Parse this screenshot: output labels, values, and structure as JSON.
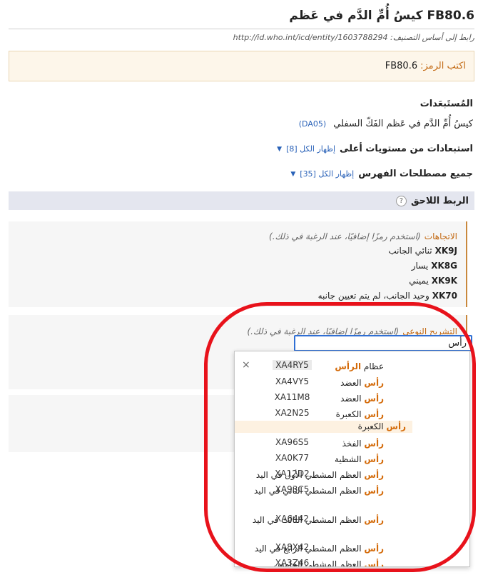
{
  "header": {
    "code": "FB80.6",
    "title": "كيسُ أُمِّ الدَّم في عَظم",
    "uri_label": "رابط إلى أساس التصنيف:",
    "uri": "http://id.who.int/icd/entity/1603788294"
  },
  "code_box": {
    "label": "اكتب الرمز:",
    "code": "FB80.6"
  },
  "exclusions": {
    "heading": "المُستَبعَدات",
    "item_text": "كيسُ أُمِّ الدَّم في عَظم الفَكّ السفلي",
    "item_ref": "(DA05)"
  },
  "higher_exclusions": {
    "label": "استبعادات من مستويات أعلى",
    "show_all": "إظهار الكل [8]"
  },
  "index_terms": {
    "label": "جميع مصطلحات الفهرس",
    "show_all": "إظهار الكل [35]"
  },
  "postcoordination": {
    "label": "الربط اللاحق",
    "help": "?"
  },
  "laterality": {
    "name": "الاتجاهات",
    "hint": "(استخدم رمزًا إضافيًا، عند الرغبة في ذلك.)",
    "items": [
      {
        "code": "XK9J",
        "label": "ثنائي الجانب"
      },
      {
        "code": "XK8G",
        "label": "يسار"
      },
      {
        "code": "XK9K",
        "label": "يميني"
      },
      {
        "code": "XK70",
        "label": "وحيد الجانب، لم يتم تعيين جانبه"
      }
    ]
  },
  "anatomy": {
    "name": "التشريح النوعي",
    "hint": "(استخدم رمزًا إضافيًا، عند الرغبة في ذلك.)",
    "input_value": "رأس"
  },
  "dropdown": {
    "close": "×",
    "items": [
      {
        "code": "XA4RY5",
        "pre": "عظام ",
        "hl": "الرأس",
        "post": ""
      },
      {
        "code": "XA4VY5",
        "pre": "",
        "hl": "رأس",
        "post": " العضد"
      },
      {
        "code": "XA11M8",
        "pre": "",
        "hl": "رأس",
        "post": " العضد"
      },
      {
        "code": "XA2N25",
        "pre": "",
        "hl": "رأس",
        "post": " الكعبرة"
      },
      {
        "code": "XA96S5",
        "pre": "",
        "hl": "رأس",
        "post": " الفخذ"
      },
      {
        "code": "XA0K77",
        "pre": "",
        "hl": "رأس",
        "post": " الشظية"
      },
      {
        "code": "XA12D2",
        "pre": "",
        "hl": "رأس",
        "post": " العظم المشطي الأول في اليد"
      },
      {
        "code": "XA93C5",
        "pre": "",
        "hl": "رأس",
        "post": " العظم المشطي الثاني في اليد"
      },
      {
        "code": "XA6442",
        "pre": "",
        "hl": "رأس",
        "post": " العظم المشطي الثالث في اليد"
      },
      {
        "code": "XA8X42",
        "pre": "",
        "hl": "رأس",
        "post": " العظم المشطي الرابع في اليد"
      },
      {
        "code": "XA3Z46",
        "pre": "",
        "hl": "رأس",
        "post": " العظم المشطي الخامس"
      }
    ],
    "sub_item": {
      "hl": "رأس",
      "post": " الكعبرة"
    }
  }
}
